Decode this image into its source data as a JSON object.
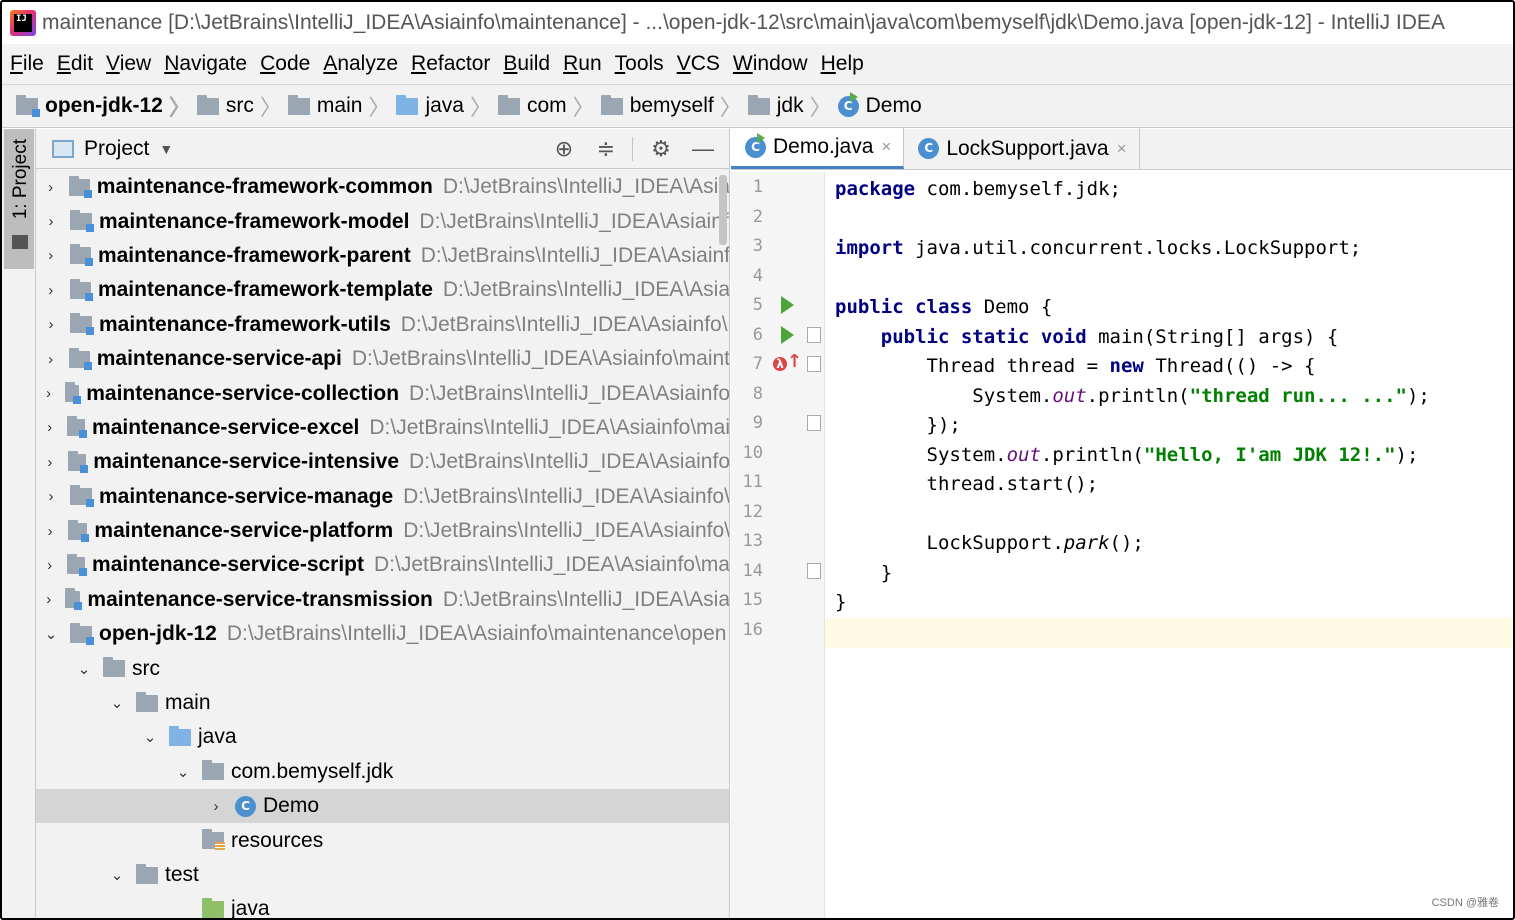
{
  "window": {
    "title": "maintenance [D:\\JetBrains\\IntelliJ_IDEA\\Asiainfo\\maintenance] - ...\\open-jdk-12\\src\\main\\java\\com\\bemyself\\jdk\\Demo.java [open-jdk-12] - IntelliJ IDEA",
    "app_icon_text": "IJ"
  },
  "menu": [
    "File",
    "Edit",
    "View",
    "Navigate",
    "Code",
    "Analyze",
    "Refactor",
    "Build",
    "Run",
    "Tools",
    "VCS",
    "Window",
    "Help"
  ],
  "breadcrumb": [
    "open-jdk-12",
    "src",
    "main",
    "java",
    "com",
    "bemyself",
    "jdk",
    "Demo"
  ],
  "side_tab": "1: Project",
  "project_panel": {
    "title": "Project",
    "caret": "▼",
    "tools": [
      "⊕",
      "≑",
      "⚙",
      "—"
    ]
  },
  "tree": [
    {
      "indent": 0,
      "arrow": "›",
      "icon": "module",
      "name": "maintenance-framework-common",
      "bold": true,
      "path": "D:\\JetBrains\\IntelliJ_IDEA\\Asia"
    },
    {
      "indent": 0,
      "arrow": "›",
      "icon": "module",
      "name": "maintenance-framework-model",
      "bold": true,
      "path": "D:\\JetBrains\\IntelliJ_IDEA\\Asiainf"
    },
    {
      "indent": 0,
      "arrow": "›",
      "icon": "module",
      "name": "maintenance-framework-parent",
      "bold": true,
      "path": "D:\\JetBrains\\IntelliJ_IDEA\\Asiainf"
    },
    {
      "indent": 0,
      "arrow": "›",
      "icon": "module",
      "name": "maintenance-framework-template",
      "bold": true,
      "path": "D:\\JetBrains\\IntelliJ_IDEA\\Asia"
    },
    {
      "indent": 0,
      "arrow": "›",
      "icon": "module",
      "name": "maintenance-framework-utils",
      "bold": true,
      "path": "D:\\JetBrains\\IntelliJ_IDEA\\Asiainfo\\"
    },
    {
      "indent": 0,
      "arrow": "›",
      "icon": "module",
      "name": "maintenance-service-api",
      "bold": true,
      "path": "D:\\JetBrains\\IntelliJ_IDEA\\Asiainfo\\maint"
    },
    {
      "indent": 0,
      "arrow": "›",
      "icon": "module",
      "name": "maintenance-service-collection",
      "bold": true,
      "path": "D:\\JetBrains\\IntelliJ_IDEA\\Asiainfo"
    },
    {
      "indent": 0,
      "arrow": "›",
      "icon": "module",
      "name": "maintenance-service-excel",
      "bold": true,
      "path": "D:\\JetBrains\\IntelliJ_IDEA\\Asiainfo\\mai"
    },
    {
      "indent": 0,
      "arrow": "›",
      "icon": "module",
      "name": "maintenance-service-intensive",
      "bold": true,
      "path": "D:\\JetBrains\\IntelliJ_IDEA\\Asiainfo"
    },
    {
      "indent": 0,
      "arrow": "›",
      "icon": "module",
      "name": "maintenance-service-manage",
      "bold": true,
      "path": "D:\\JetBrains\\IntelliJ_IDEA\\Asiainfo\\"
    },
    {
      "indent": 0,
      "arrow": "›",
      "icon": "module",
      "name": "maintenance-service-platform",
      "bold": true,
      "path": "D:\\JetBrains\\IntelliJ_IDEA\\Asiainfo\\"
    },
    {
      "indent": 0,
      "arrow": "›",
      "icon": "module",
      "name": "maintenance-service-script",
      "bold": true,
      "path": "D:\\JetBrains\\IntelliJ_IDEA\\Asiainfo\\ma"
    },
    {
      "indent": 0,
      "arrow": "›",
      "icon": "module",
      "name": "maintenance-service-transmission",
      "bold": true,
      "path": "D:\\JetBrains\\IntelliJ_IDEA\\Asia"
    },
    {
      "indent": 0,
      "arrow": "⌄",
      "icon": "module",
      "name": "open-jdk-12",
      "bold": true,
      "path": "D:\\JetBrains\\IntelliJ_IDEA\\Asiainfo\\maintenance\\open"
    },
    {
      "indent": 1,
      "arrow": "⌄",
      "icon": "folder",
      "name": "src",
      "bold": false,
      "path": ""
    },
    {
      "indent": 2,
      "arrow": "⌄",
      "icon": "folder",
      "name": "main",
      "bold": false,
      "path": ""
    },
    {
      "indent": 3,
      "arrow": "⌄",
      "icon": "source",
      "name": "java",
      "bold": false,
      "path": ""
    },
    {
      "indent": 4,
      "arrow": "⌄",
      "icon": "package",
      "name": "com.bemyself.jdk",
      "bold": false,
      "path": ""
    },
    {
      "indent": 5,
      "arrow": "›",
      "icon": "class",
      "name": "Demo",
      "bold": false,
      "path": "",
      "selected": true
    },
    {
      "indent": 4,
      "arrow": "",
      "icon": "resources",
      "name": "resources",
      "bold": false,
      "path": ""
    },
    {
      "indent": 2,
      "arrow": "⌄",
      "icon": "folder",
      "name": "test",
      "bold": false,
      "path": ""
    },
    {
      "indent": 4,
      "arrow": "",
      "icon": "testsrc",
      "name": "java",
      "bold": false,
      "path": ""
    }
  ],
  "editor": {
    "tabs": [
      {
        "label": "Demo.java",
        "active": true,
        "close": "×"
      },
      {
        "label": "LockSupport.java",
        "active": false,
        "close": "×"
      }
    ],
    "class_icon_letter": "C",
    "line_numbers": [
      "1",
      "2",
      "3",
      "4",
      "5",
      "6",
      "7",
      "8",
      "9",
      "10",
      "11",
      "12",
      "13",
      "14",
      "15",
      "16"
    ],
    "lambda_mark": "λ",
    "lambda_arrow": "↑",
    "code": [
      [
        {
          "t": "kw",
          "v": "package"
        },
        {
          "t": "",
          "v": " com.bemyself.jdk;"
        }
      ],
      [],
      [
        {
          "t": "kw",
          "v": "import"
        },
        {
          "t": "",
          "v": " java.util.concurrent.locks.LockSupport;"
        }
      ],
      [],
      [
        {
          "t": "kw",
          "v": "public class"
        },
        {
          "t": "",
          "v": " Demo {"
        }
      ],
      [
        {
          "t": "",
          "v": "    "
        },
        {
          "t": "kw",
          "v": "public static void"
        },
        {
          "t": "",
          "v": " main(String[] args) {"
        }
      ],
      [
        {
          "t": "",
          "v": "        Thread thread = "
        },
        {
          "t": "kw",
          "v": "new"
        },
        {
          "t": "",
          "v": " Thread(() -> {"
        }
      ],
      [
        {
          "t": "",
          "v": "            System."
        },
        {
          "t": "fld",
          "v": "out"
        },
        {
          "t": "",
          "v": ".println("
        },
        {
          "t": "str",
          "v": "\"thread run... ...\""
        },
        {
          "t": "",
          "v": ");"
        }
      ],
      [
        {
          "t": "",
          "v": "        });"
        }
      ],
      [
        {
          "t": "",
          "v": "        System."
        },
        {
          "t": "fld",
          "v": "out"
        },
        {
          "t": "",
          "v": ".println("
        },
        {
          "t": "str",
          "v": "\"Hello, I'am JDK 12!.\""
        },
        {
          "t": "",
          "v": ");"
        }
      ],
      [
        {
          "t": "",
          "v": "        thread.start();"
        }
      ],
      [],
      [
        {
          "t": "",
          "v": "        LockSupport."
        },
        {
          "t": "itl",
          "v": "park"
        },
        {
          "t": "",
          "v": "();"
        }
      ],
      [
        {
          "t": "",
          "v": "    }"
        }
      ],
      [
        {
          "t": "",
          "v": "}"
        }
      ],
      []
    ]
  },
  "watermark": "CSDN @雅卷"
}
